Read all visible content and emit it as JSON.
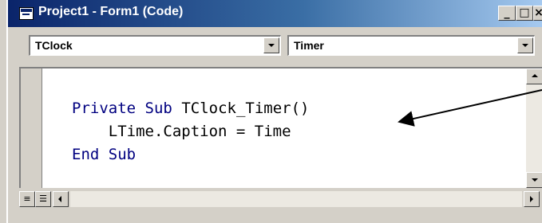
{
  "window": {
    "title": "Project1 - Form1 (Code)",
    "minimize_label": "_",
    "maximize_label": "□",
    "close_label": "×"
  },
  "object_combo": {
    "value": "TClock"
  },
  "procedure_combo": {
    "value": "Timer"
  },
  "code": {
    "keyword_private": "Private",
    "keyword_sub": "Sub",
    "procedure_name": "TClock_Timer()",
    "line2": "    LTime.Caption = Time",
    "keyword_end": "End",
    "keyword_sub_end": "Sub"
  },
  "colors": {
    "keyword": "#000080",
    "title_gradient_start": "#0a246a",
    "title_gradient_end": "#a6caf0",
    "arrow": "#000000"
  },
  "icons": {
    "window_icon": "form-code-icon",
    "procedure_view": "procedure-view-icon",
    "full_module_view": "full-module-view-icon"
  }
}
